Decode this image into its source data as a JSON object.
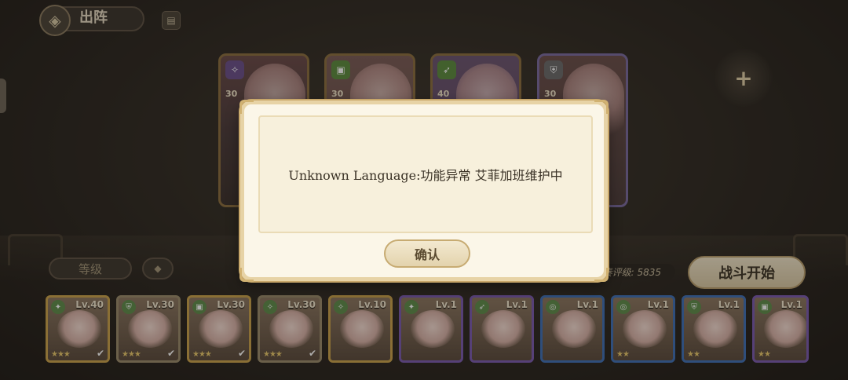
{
  "header": {
    "title": "出阵",
    "emblem_icon": "formation-emblem-icon",
    "book_icon": "codex-book-icon"
  },
  "team": [
    {
      "level": "30",
      "class_icon": "mage-class-icon"
    },
    {
      "level": "30",
      "class_icon": "support-class-icon"
    },
    {
      "level": "40",
      "class_icon": "ranger-class-icon"
    },
    {
      "level": "30",
      "class_icon": "defender-class-icon"
    }
  ],
  "add_slot_icon": "plus-icon",
  "controls": {
    "sort_label": "等级",
    "sort_toggle_icon": "sort-order-icon",
    "power_text": "合奏评级: 5835",
    "start_label": "战斗开始"
  },
  "roster": [
    {
      "level": "Lv.40",
      "stars": "★★★",
      "check": "✔",
      "frame": "gold"
    },
    {
      "level": "Lv.30",
      "stars": "★★★",
      "check": "✔",
      "frame": "plain"
    },
    {
      "level": "Lv.30",
      "stars": "★★★",
      "check": "✔",
      "frame": "gold"
    },
    {
      "level": "Lv.30",
      "stars": "★★★",
      "check": "✔",
      "frame": "plain"
    },
    {
      "level": "Lv.10",
      "stars": "",
      "check": "",
      "frame": "gold"
    },
    {
      "level": "Lv.1",
      "stars": "",
      "check": "",
      "frame": "purple"
    },
    {
      "level": "Lv.1",
      "stars": "",
      "check": "",
      "frame": "purple"
    },
    {
      "level": "Lv.1",
      "stars": "",
      "check": "",
      "frame": "blue"
    },
    {
      "level": "Lv.1",
      "stars": "★★",
      "check": "",
      "frame": "blue"
    },
    {
      "level": "Lv.1",
      "stars": "★★",
      "check": "",
      "frame": "blue"
    },
    {
      "level": "Lv.1",
      "stars": "★★",
      "check": "",
      "frame": "purple"
    }
  ],
  "dialog": {
    "message": "Unknown Language:功能异常 艾菲加班维护中",
    "confirm_label": "确认"
  },
  "colors": {
    "background": "#2e2a24",
    "dialog_bg": "#fbf6e8",
    "dialog_border": "#e7d3a6",
    "frame_gold": "#c9a24a",
    "frame_purple": "#7a5ab0",
    "frame_blue": "#3e6fb5"
  }
}
